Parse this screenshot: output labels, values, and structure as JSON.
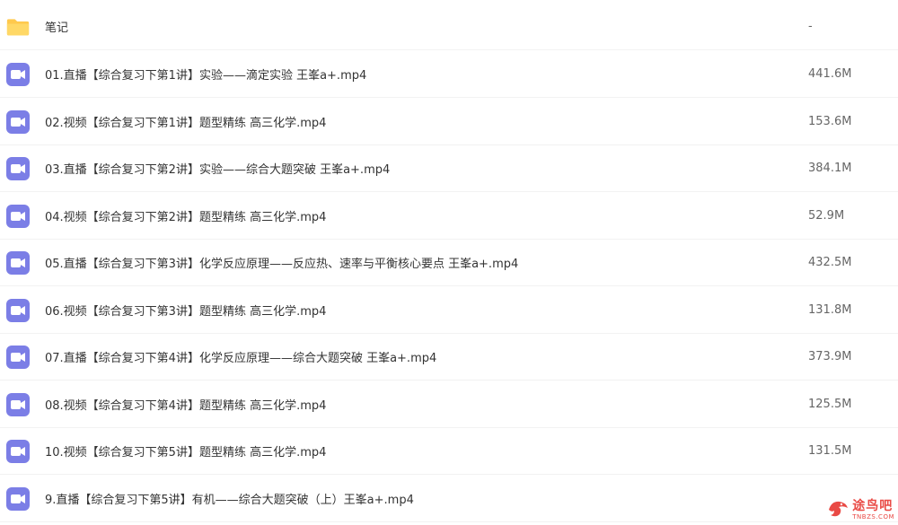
{
  "files": [
    {
      "icon": "folder-icon",
      "name": "笔记",
      "size": "-"
    },
    {
      "icon": "video-file-icon",
      "name": "01.直播【综合复习下第1讲】实验——滴定实验 王峯a+.mp4",
      "size": "441.6M"
    },
    {
      "icon": "video-file-icon",
      "name": "02.视频【综合复习下第1讲】题型精练 高三化学.mp4",
      "size": "153.6M"
    },
    {
      "icon": "video-file-icon",
      "name": "03.直播【综合复习下第2讲】实验——综合大题突破 王峯a+.mp4",
      "size": "384.1M"
    },
    {
      "icon": "video-file-icon",
      "name": "04.视频【综合复习下第2讲】题型精练 高三化学.mp4",
      "size": "52.9M"
    },
    {
      "icon": "video-file-icon",
      "name": "05.直播【综合复习下第3讲】化学反应原理——反应热、速率与平衡核心要点 王峯a+.mp4",
      "size": "432.5M"
    },
    {
      "icon": "video-file-icon",
      "name": "06.视频【综合复习下第3讲】题型精练 高三化学.mp4",
      "size": "131.8M"
    },
    {
      "icon": "video-file-icon",
      "name": "07.直播【综合复习下第4讲】化学反应原理——综合大题突破 王峯a+.mp4",
      "size": "373.9M"
    },
    {
      "icon": "video-file-icon",
      "name": "08.视频【综合复习下第4讲】题型精练 高三化学.mp4",
      "size": "125.5M"
    },
    {
      "icon": "video-file-icon",
      "name": "10.视频【综合复习下第5讲】题型精练 高三化学.mp4",
      "size": "131.5M"
    },
    {
      "icon": "video-file-icon",
      "name": "9.直播【综合复习下第5讲】有机——综合大题突破（上）王峯a+.mp4",
      "size": ""
    }
  ],
  "watermark": {
    "main": "途鸟吧",
    "sub": "TNBZS.COM"
  },
  "colors": {
    "folder": "#ffc94d",
    "video_icon": "#7b7ee6",
    "watermark": "#e8413c"
  }
}
